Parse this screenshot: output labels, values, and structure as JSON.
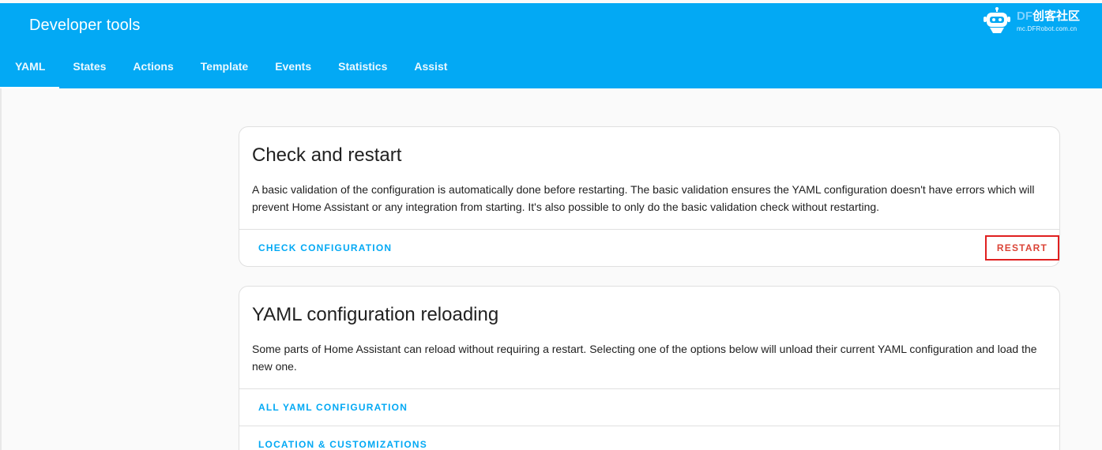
{
  "header": {
    "title": "Developer tools",
    "tabs": [
      {
        "label": "YAML"
      },
      {
        "label": "States"
      },
      {
        "label": "Actions"
      },
      {
        "label": "Template"
      },
      {
        "label": "Events"
      },
      {
        "label": "Statistics"
      },
      {
        "label": "Assist"
      }
    ],
    "active_tab": "YAML",
    "logo": {
      "brand_prefix": "DF",
      "brand_main": "创客社区",
      "url_text": "mc.DFRobot.com.cn"
    }
  },
  "check_card": {
    "title": "Check and restart",
    "description": "A basic validation of the configuration is automatically done before restarting. The basic validation ensures the YAML configuration doesn't have errors which will prevent Home Assistant or any integration from starting. It's also possible to only do the basic validation check without restarting.",
    "check_button": "CHECK CONFIGURATION",
    "restart_button": "RESTART"
  },
  "reload_card": {
    "title": "YAML configuration reloading",
    "description": "Some parts of Home Assistant can reload without requiring a restart. Selecting one of the options below will unload their current YAML configuration and load the new one.",
    "items": [
      {
        "label": "ALL YAML CONFIGURATION"
      },
      {
        "label": "LOCATION & CUSTOMIZATIONS"
      }
    ]
  },
  "colors": {
    "primary": "#03a9f4",
    "restart": "#db4437",
    "highlight_box": "#e02020"
  }
}
